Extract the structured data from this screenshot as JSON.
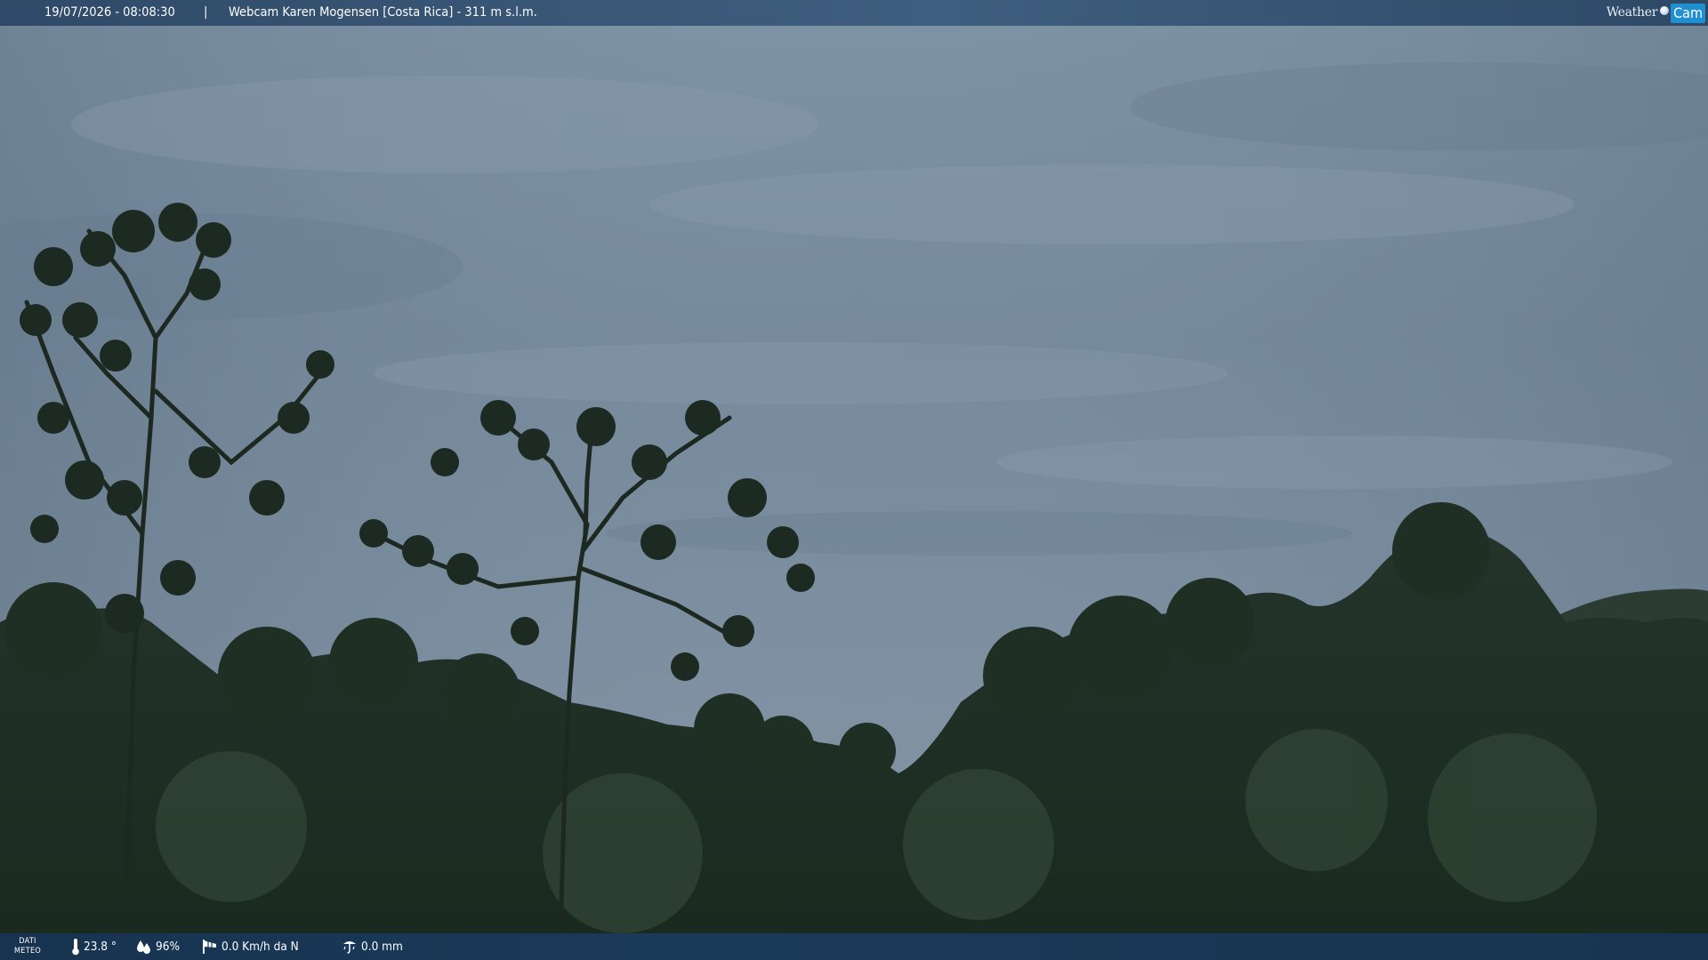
{
  "header": {
    "timestamp": "19/07/2026 - 08:08:30",
    "separator": "|",
    "camera_title": "Webcam Karen Mogensen [Costa Rica]  - 311 m s.l.m."
  },
  "brand": {
    "weather": "Weather",
    "cam": "Cam"
  },
  "footer": {
    "data_label_line1": "DATI",
    "data_label_line2": "METEO",
    "temperature": "23.8 °",
    "humidity": "96%",
    "wind": "0.0 Km/h da N",
    "rain": "0.0 mm"
  },
  "icons": {
    "temperature": "thermometer-icon",
    "humidity": "humidity-icon",
    "wind": "windsock-icon",
    "rain": "rain-gauge-icon"
  },
  "colors": {
    "top_bar": "#3a5677",
    "bottom_bar": "#1a3a5a",
    "brand_cam": "#1f8fd1",
    "sky": "#7a8fa0",
    "foliage": "#1b2a20"
  }
}
